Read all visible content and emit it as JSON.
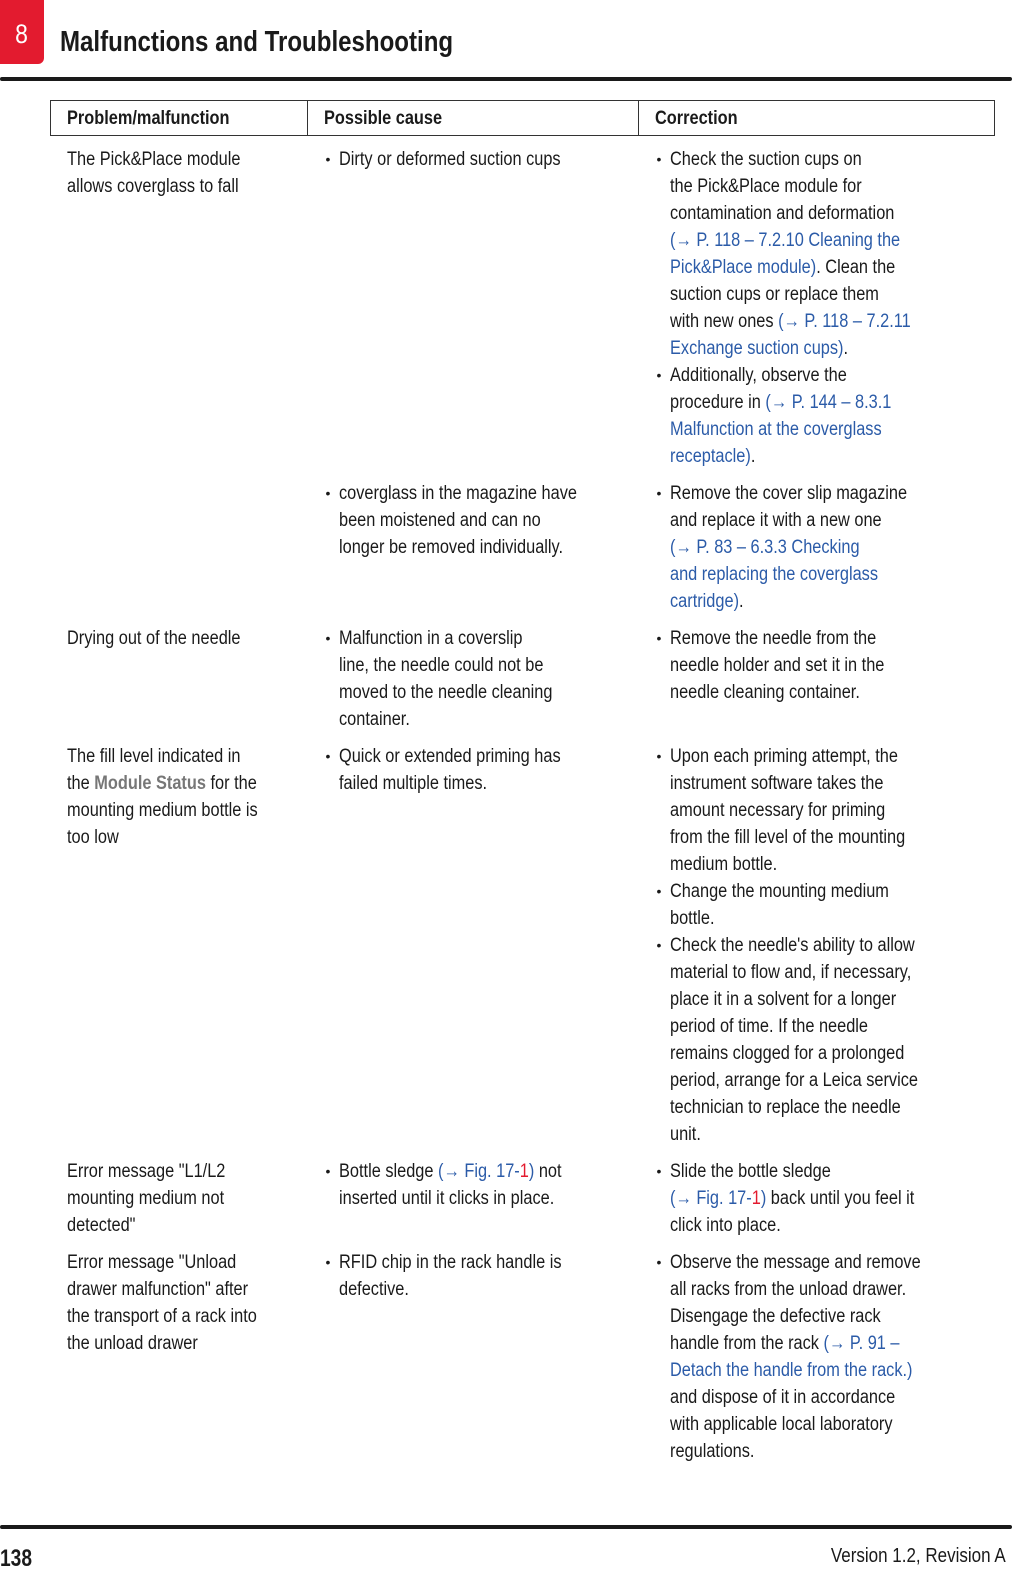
{
  "header": {
    "chapter_number": "8",
    "title": "Malfunctions and Troubleshooting"
  },
  "table": {
    "columns": [
      "Problem/malfunction",
      "Possible cause",
      "Correction"
    ],
    "rows": [
      {
        "problem": [
          [
            {
              "t": "The Pick&Place module"
            }
          ],
          [
            {
              "t": "allows coverglass to fall"
            }
          ]
        ],
        "causes": [
          [
            [
              {
                "t": "Dirty or deformed suction cups"
              }
            ]
          ]
        ],
        "corrections": [
          [
            [
              {
                "t": "Check the suction cups on"
              }
            ],
            [
              {
                "t": "the Pick&Place module for"
              }
            ],
            [
              {
                "t": "contamination and deformation"
              }
            ],
            [
              {
                "t": "(→ P. 118 – 7.2.10 Cleaning the",
                "s": "link"
              }
            ],
            [
              {
                "t": "Pick&Place module)",
                "s": "link"
              },
              {
                "t": ". Clean the"
              }
            ],
            [
              {
                "t": "suction cups or replace them"
              }
            ],
            [
              {
                "t": "with new ones "
              },
              {
                "t": "(→ P. 118 – 7.2.11",
                "s": "link"
              }
            ],
            [
              {
                "t": "Exchange suction cups)",
                "s": "link"
              },
              {
                "t": "."
              }
            ]
          ],
          [
            [
              {
                "t": "Additionally, observe the"
              }
            ],
            [
              {
                "t": "procedure in "
              },
              {
                "t": "(→ P. 144 – 8.3.1",
                "s": "link"
              }
            ],
            [
              {
                "t": "Malfunction at the coverglass",
                "s": "link"
              }
            ],
            [
              {
                "t": "receptacle)",
                "s": "link"
              },
              {
                "t": "."
              }
            ]
          ]
        ]
      },
      {
        "problem": [],
        "causes": [
          [
            [
              {
                "t": "coverglass in the magazine have"
              }
            ],
            [
              {
                "t": "been moistened and can no"
              }
            ],
            [
              {
                "t": "longer be removed individually."
              }
            ]
          ]
        ],
        "corrections": [
          [
            [
              {
                "t": "Remove the cover slip magazine"
              }
            ],
            [
              {
                "t": "and replace it with a new one"
              }
            ],
            [
              {
                "t": "(→ P. 83 – 6.3.3 Checking",
                "s": "link"
              }
            ],
            [
              {
                "t": "and replacing the coverglass",
                "s": "link"
              }
            ],
            [
              {
                "t": "cartridge)",
                "s": "link"
              },
              {
                "t": "."
              }
            ]
          ]
        ]
      },
      {
        "problem": [
          [
            {
              "t": "Drying out of the needle"
            }
          ]
        ],
        "causes": [
          [
            [
              {
                "t": "Malfunction in a coverslip"
              }
            ],
            [
              {
                "t": "line, the needle could not be"
              }
            ],
            [
              {
                "t": "moved to the needle cleaning"
              }
            ],
            [
              {
                "t": "container."
              }
            ]
          ]
        ],
        "corrections": [
          [
            [
              {
                "t": "Remove the needle from the"
              }
            ],
            [
              {
                "t": "needle holder and set it in the"
              }
            ],
            [
              {
                "t": "needle cleaning container."
              }
            ]
          ]
        ]
      },
      {
        "problem": [
          [
            {
              "t": "The fill level indicated in"
            }
          ],
          [
            {
              "t": "the "
            },
            {
              "t": "Module Status",
              "s": "bold-gray"
            },
            {
              "t": " for the"
            }
          ],
          [
            {
              "t": "mounting medium bottle is"
            }
          ],
          [
            {
              "t": "too low"
            }
          ]
        ],
        "causes": [
          [
            [
              {
                "t": "Quick or extended priming has"
              }
            ],
            [
              {
                "t": "failed multiple times."
              }
            ]
          ]
        ],
        "corrections": [
          [
            [
              {
                "t": "Upon each priming attempt, the"
              }
            ],
            [
              {
                "t": "instrument software takes the"
              }
            ],
            [
              {
                "t": "amount necessary for priming"
              }
            ],
            [
              {
                "t": "from the fill level of the mounting"
              }
            ],
            [
              {
                "t": "medium bottle."
              }
            ]
          ],
          [
            [
              {
                "t": "Change the mounting medium"
              }
            ],
            [
              {
                "t": "bottle."
              }
            ]
          ],
          [
            [
              {
                "t": "Check the needle's ability to allow"
              }
            ],
            [
              {
                "t": "material to flow and, if necessary,"
              }
            ],
            [
              {
                "t": "place it in a solvent for a longer"
              }
            ],
            [
              {
                "t": "period of time. If the needle"
              }
            ],
            [
              {
                "t": "remains clogged for a prolonged"
              }
            ],
            [
              {
                "t": "period, arrange for a Leica service"
              }
            ],
            [
              {
                "t": "technician to replace the needle"
              }
            ],
            [
              {
                "t": "unit."
              }
            ]
          ]
        ]
      },
      {
        "problem": [
          [
            {
              "t": "Error message \"L1/L2"
            }
          ],
          [
            {
              "t": "mounting medium not"
            }
          ],
          [
            {
              "t": "detected\""
            }
          ]
        ],
        "causes": [
          [
            [
              {
                "t": "Bottle sledge "
              },
              {
                "t": "(→ Fig.  17-",
                "s": "link"
              },
              {
                "t": "1",
                "s": "red"
              },
              {
                "t": ")",
                "s": "link"
              },
              {
                "t": " not"
              }
            ],
            [
              {
                "t": "inserted until it clicks in place."
              }
            ]
          ]
        ],
        "corrections": [
          [
            [
              {
                "t": "Slide the bottle sledge"
              }
            ],
            [
              {
                "t": "(→ Fig.  17-",
                "s": "link"
              },
              {
                "t": "1",
                "s": "red"
              },
              {
                "t": ")",
                "s": "link"
              },
              {
                "t": " back until you feel it"
              }
            ],
            [
              {
                "t": "click into place."
              }
            ]
          ]
        ]
      },
      {
        "problem": [
          [
            {
              "t": "Error message \"Unload"
            }
          ],
          [
            {
              "t": "drawer malfunction\" after"
            }
          ],
          [
            {
              "t": "the transport of a rack into"
            }
          ],
          [
            {
              "t": "the unload drawer"
            }
          ]
        ],
        "causes": [
          [
            [
              {
                "t": "RFID chip in the rack handle is"
              }
            ],
            [
              {
                "t": "defective."
              }
            ]
          ]
        ],
        "corrections": [
          [
            [
              {
                "t": "Observe the message and remove"
              }
            ],
            [
              {
                "t": "all racks from the unload drawer."
              }
            ],
            [
              {
                "t": "Disengage the defective rack"
              }
            ],
            [
              {
                "t": "handle from the rack "
              },
              {
                "t": "(→ P. 91 –",
                "s": "link"
              }
            ],
            [
              {
                "t": "Detach the handle from the rack.)",
                "s": "link"
              }
            ],
            [
              {
                "t": "and dispose of it in accordance"
              }
            ],
            [
              {
                "t": "with applicable local laboratory"
              }
            ],
            [
              {
                "t": "regulations."
              }
            ]
          ]
        ]
      }
    ]
  },
  "footer": {
    "page_number": "138",
    "version": "Version 1.2, Revision A"
  },
  "colors": {
    "brand_red": "#e31b2f",
    "link_blue": "#2b5ba8",
    "ui_term_gray": "#777777"
  }
}
